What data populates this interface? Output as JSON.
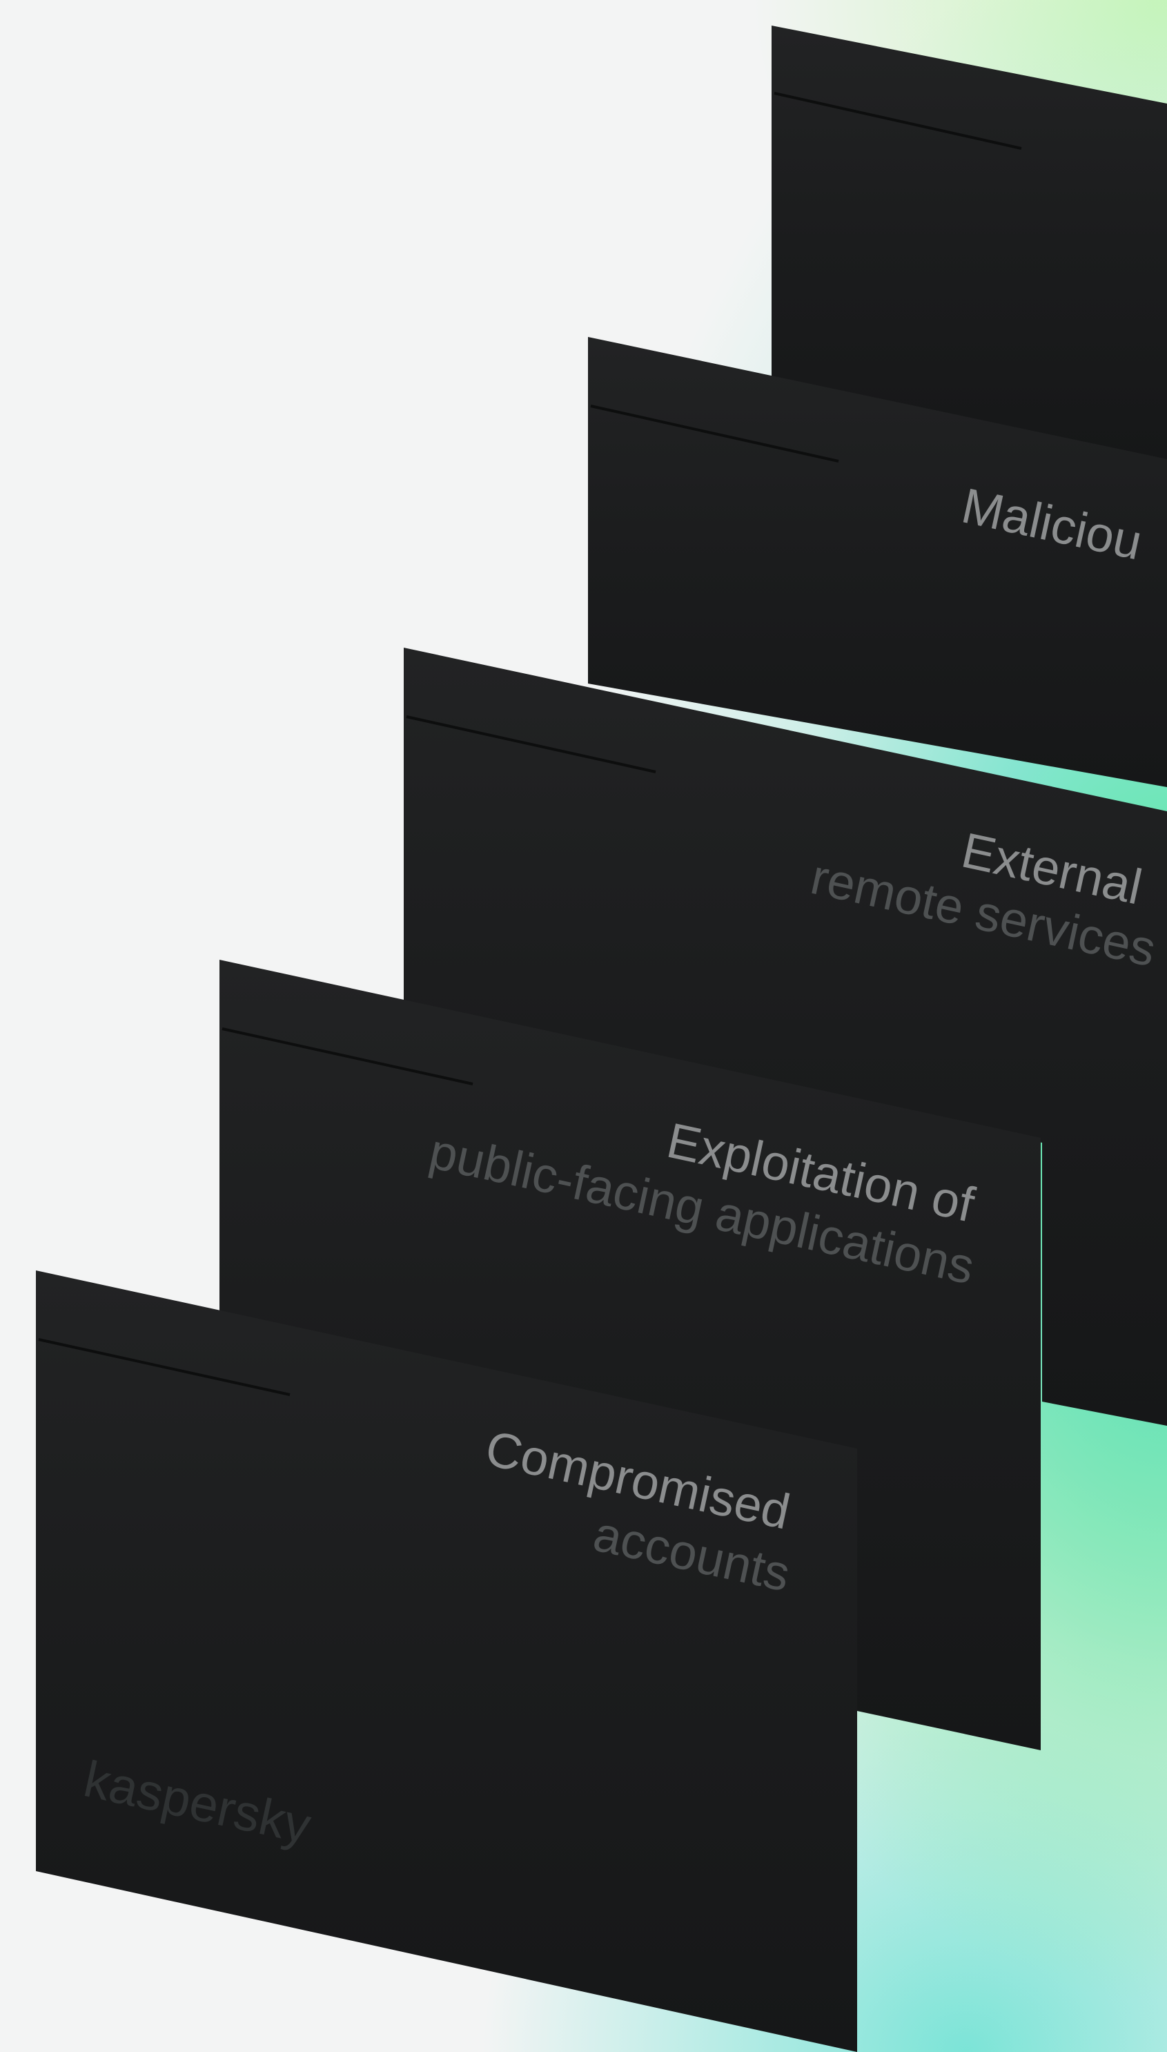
{
  "cards": [
    {
      "line1": "",
      "line2": ""
    },
    {
      "line1": "Maliciou",
      "line2": ""
    },
    {
      "line1": "External",
      "line2": "remote services"
    },
    {
      "line1": "Exploitation of",
      "line2": "public-facing applications"
    },
    {
      "line1": "Compromised",
      "line2": "accounts"
    }
  ],
  "brand": {
    "logo_text": "kaspersky"
  },
  "colors": {
    "card": "#1a1b1c",
    "accent_green": "#4ae894",
    "accent_teal": "#60e0c4",
    "background": "#f3f4f4"
  }
}
